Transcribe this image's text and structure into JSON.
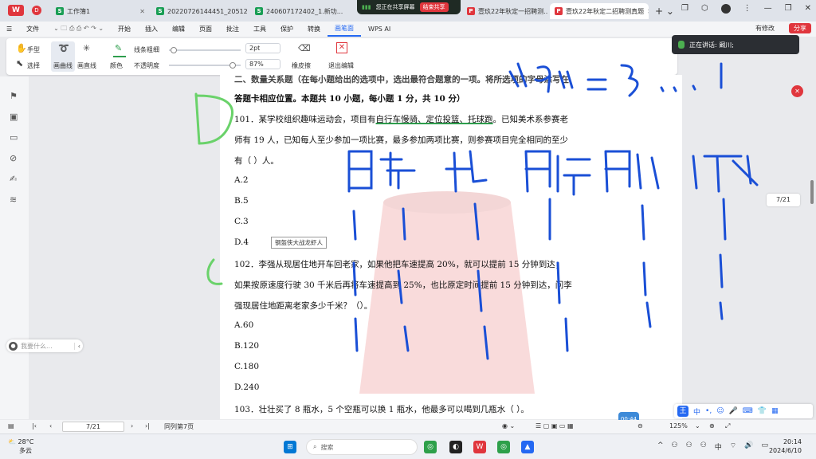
{
  "tabs": [
    {
      "label": "工作簿1",
      "icon": "S"
    },
    {
      "label": "20220726144451_20512",
      "icon": "S"
    },
    {
      "label": "240607172402_1.新功...",
      "icon": "S"
    },
    {
      "label": "壹玖22年秋定一招聘测...",
      "icon": "P"
    },
    {
      "label": "壹玖22年秋定二招聘测真题",
      "icon": "P"
    }
  ],
  "share_pill": {
    "text": "您正在共享屏幕",
    "end": "结束共享"
  },
  "menu": {
    "file": "文件",
    "items": [
      "开始",
      "插入",
      "编辑",
      "页面",
      "批注",
      "工具",
      "保护",
      "转换",
      "画笔面"
    ],
    "active": "画笔面",
    "wps_ai": "WPS AI",
    "modify": "有修改",
    "share": "分享"
  },
  "ribbon": {
    "hand": "手型",
    "select": "选择",
    "pen1": "画曲线",
    "pen2": "画直线",
    "color": "颜色",
    "thickness": "线条粗细",
    "opacity": "不透明度",
    "thickness_value": "2pt",
    "opacity_value": "87%",
    "eraser": "橡皮擦",
    "exit": "退出编辑"
  },
  "live": {
    "text": "正在讲话: 阚川;"
  },
  "doc": {
    "line0": "二、数量关系题（在每小题给出的选项中，选出最符合题意的一项。将所选项的字母涂写在",
    "line1": "答题卡相应位置。本题共 10 小题，每小题 1 分，共 10 分）",
    "q101a": "101．某学校组织趣味运动会，项目有",
    "q101u": "自行车慢骑、定位投篮、托球跑",
    "q101b": "。已知美术系参赛老",
    "q101c": "师有 19 人，已知每人至少参加一项比赛，最多参加两项比赛，则参赛项目完全相同的至少",
    "q101d": "有（    ）人。",
    "opts101": [
      "A.2",
      "B.5",
      "C.3",
      "D.4"
    ],
    "tooltip": "钢盔侠大战龙虾人",
    "q102a": "102．李强从现居住地开车回老家，如果他把车速提高 20%，就可以提前 15 分钟到达；",
    "q102b": "如果按原速度行驶 30 千米后再将车速提高到 25%，也比原定时间提前 15 分钟到达，问李",
    "q102c": "强现居住地距离老家多少千米？（）。",
    "opts102": [
      "A.60",
      "B.120",
      "C.180",
      "D.240"
    ],
    "q103": "103．壮壮买了 8 瓶水，5 个空瓶可以换 1 瓶水，他最多可以喝到几瓶水（    ）。"
  },
  "page_indicator": "7/21",
  "search_pill": "我要什么...",
  "status": {
    "page": "7/21",
    "words": "同列第7页",
    "zoom": "125%"
  },
  "ime": {
    "label": "中"
  },
  "recorder": "00:44",
  "taskbar": {
    "search": "搜索",
    "temp": "28°C",
    "weather": "多云",
    "time": "20:14",
    "date": "2024/6/10"
  },
  "ink_colors": {
    "green": "#6ad26a",
    "blue": "#1a4fd6"
  }
}
